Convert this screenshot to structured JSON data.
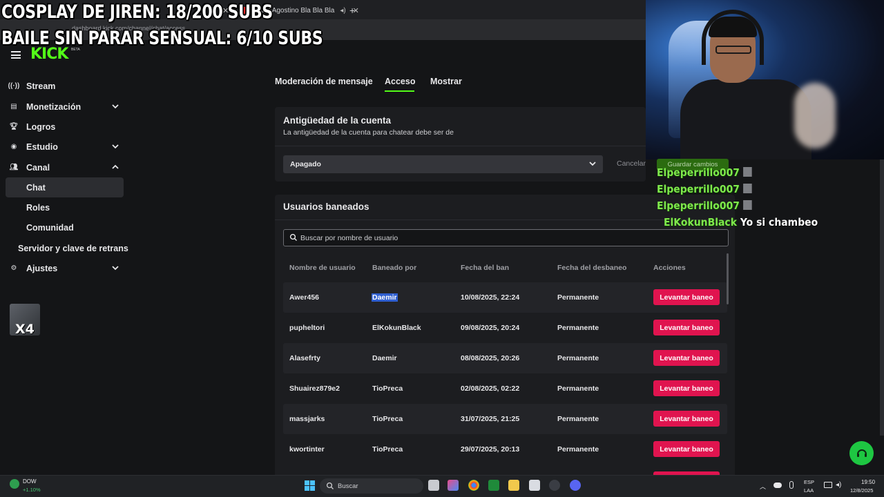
{
  "browser": {
    "tabs": [
      {
        "label": ""
      },
      {
        "label": "Gigi D'Agostino Bla Bla Bla"
      }
    ],
    "new_tab": "+",
    "url": "dashboard.kick.com/channel/chat/access"
  },
  "overlays": {
    "line1": "COSPLAY DE JIREN: 18/200 SUBS",
    "line2": "BAILE SIN PARAR SENSUAL: 6/10 SUBS"
  },
  "logo": {
    "text": "KICK",
    "badge": "BETA"
  },
  "sidebar": {
    "items": [
      {
        "label": "Stream",
        "icon": "broadcast-icon"
      },
      {
        "label": "Monetización",
        "icon": "chart-icon"
      },
      {
        "label": "Logros",
        "icon": "trophy-icon"
      },
      {
        "label": "Estudio",
        "icon": "studio-icon"
      },
      {
        "label": "Canal",
        "icon": "users-icon"
      }
    ],
    "sub_items": [
      "Chat",
      "Roles",
      "Comunidad"
    ],
    "server_item": "Servidor y clave de retrans",
    "settings": {
      "label": "Ajustes",
      "icon": "gear-icon"
    },
    "badge_text": "X4"
  },
  "page_tabs": [
    "Moderación de mensaje",
    "Acceso",
    "Mostrar"
  ],
  "account_age": {
    "title": "Antigüedad de la cuenta",
    "description": "La antigüedad de la cuenta para chatear debe ser de",
    "select_value": "Apagado",
    "cancel": "Cancelar",
    "save": "Guardar cambios"
  },
  "banned": {
    "title": "Usuarios baneados",
    "search_placeholder": "Buscar por nombre de usuario",
    "columns": [
      "Nombre de usuario",
      "Baneado por",
      "Fecha del ban",
      "Fecha del desbaneo",
      "Acciones"
    ],
    "rows": [
      {
        "user": "Awer456",
        "by": "Daemir",
        "date": "10/08/2025, 22:24",
        "until": "Permanente",
        "action": "Levantar baneo"
      },
      {
        "user": "pupheltori",
        "by": "ElKokunBlack",
        "date": "09/08/2025, 20:24",
        "until": "Permanente",
        "action": "Levantar baneo"
      },
      {
        "user": "Alasefrty",
        "by": "Daemir",
        "date": "08/08/2025, 20:26",
        "until": "Permanente",
        "action": "Levantar baneo"
      },
      {
        "user": "Shuairez879e2",
        "by": "TioPreca",
        "date": "02/08/2025, 02:22",
        "until": "Permanente",
        "action": "Levantar baneo"
      },
      {
        "user": "massjarks",
        "by": "TioPreca",
        "date": "31/07/2025, 21:25",
        "until": "Permanente",
        "action": "Levantar baneo"
      },
      {
        "user": "kwortinter",
        "by": "TioPreca",
        "date": "29/07/2025, 20:13",
        "until": "Permanente",
        "action": "Levantar baneo"
      }
    ]
  },
  "chat_overlay": [
    {
      "user": "Elpeperrillo007",
      "msg": ""
    },
    {
      "user": "Elpeperrillo007",
      "msg": ""
    },
    {
      "user": "Elpeperrillo007",
      "msg": ""
    },
    {
      "user": "ElKokunBlack",
      "msg": "Yo si chambeo"
    }
  ],
  "taskbar": {
    "ticker_name": "DOW",
    "ticker_change": "+1.10%",
    "search_label": "Buscar",
    "lang1": "ESP",
    "lang2": "LAA",
    "time": "19:50",
    "date": "12/8/2025"
  },
  "colors": {
    "accent": "#53fc18",
    "danger": "#e0144f",
    "background": "#141517",
    "card": "#1c1d20"
  }
}
